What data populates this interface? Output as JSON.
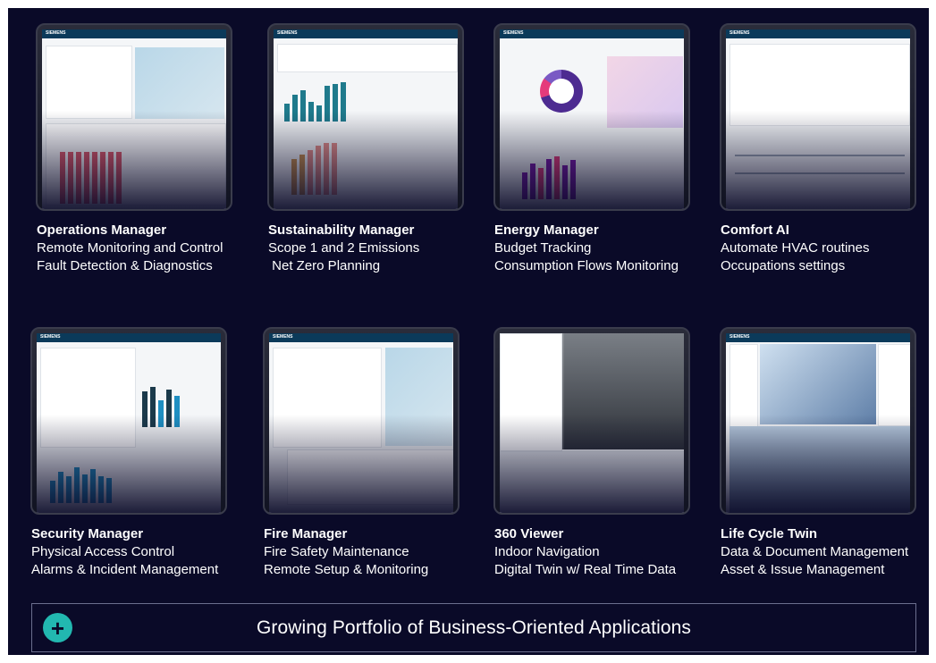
{
  "tiles": [
    {
      "title": "Operations Manager",
      "lines": [
        "Remote Monitoring and Control",
        "Fault Detection & Diagnostics"
      ],
      "screen": "ops"
    },
    {
      "title": "Sustainability Manager",
      "lines": [
        "Scope 1 and 2 Emissions",
        " Net Zero Planning"
      ],
      "screen": "sust"
    },
    {
      "title": "Energy Manager",
      "lines": [
        "Budget Tracking",
        "Consumption Flows Monitoring"
      ],
      "screen": "energy"
    },
    {
      "title": "Comfort AI",
      "lines": [
        "Automate HVAC routines",
        "Occupations settings"
      ],
      "screen": "comfort"
    },
    {
      "title": "Security Manager",
      "lines": [
        "Physical Access Control",
        "Alarms & Incident Management"
      ],
      "screen": "security"
    },
    {
      "title": "Fire Manager",
      "lines": [
        "Fire Safety Maintenance",
        "Remote Setup & Monitoring"
      ],
      "screen": "fire"
    },
    {
      "title": "360 Viewer",
      "lines": [
        "Indoor Navigation",
        "Digital Twin w/ Real Time Data"
      ],
      "screen": "viewer"
    },
    {
      "title": "Life Cycle Twin",
      "lines": [
        "Data & Document Management",
        "Asset & Issue Management"
      ],
      "screen": "lifecycle"
    }
  ],
  "footer": {
    "icon": "plus-icon",
    "text": "Growing Portfolio of Business-Oriented Applications"
  },
  "brand_text": "SIEMENS",
  "colors": {
    "background": "#0a0a28",
    "accent": "#22b8b0",
    "caption_text": "#ffffff",
    "border": "#6b6f8e"
  }
}
